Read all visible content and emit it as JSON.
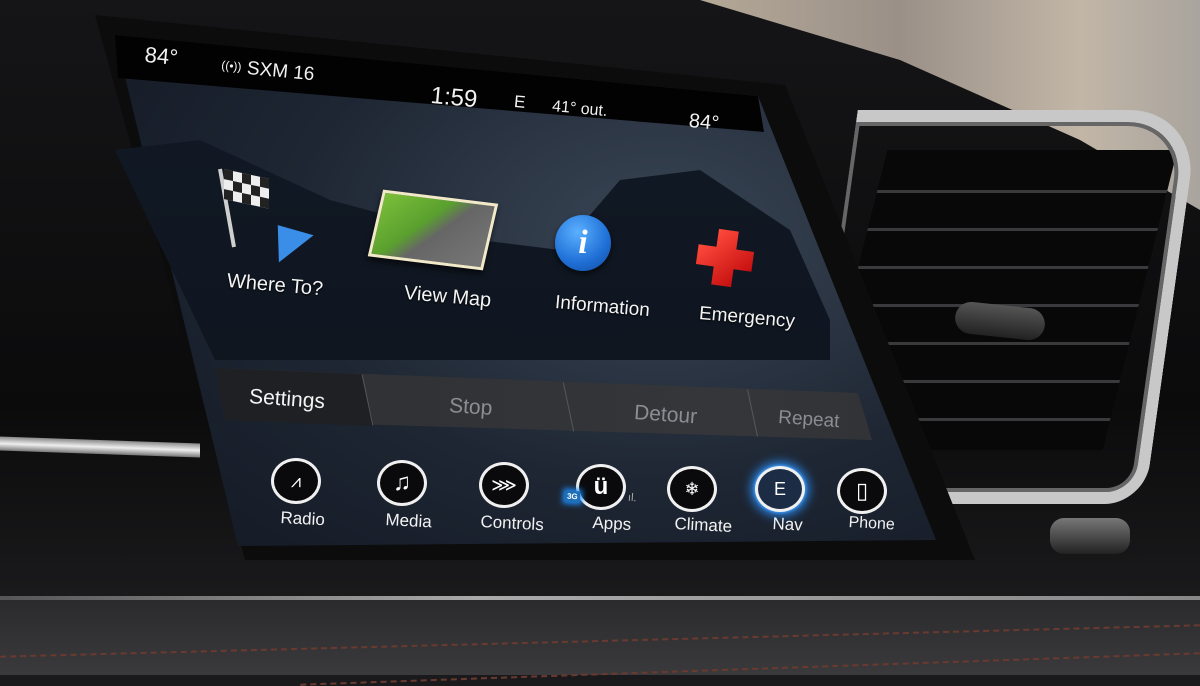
{
  "status_bar": {
    "left_temp": "84°",
    "radio_icon": "antenna-icon",
    "station": "SXM 16",
    "time": "1:59",
    "compass": "E",
    "outside_temp": "41° out.",
    "right_temp": "84°"
  },
  "nav_menu": {
    "tiles": [
      {
        "label": "Where To?",
        "icon": "checkered-flag-icon"
      },
      {
        "label": "View Map",
        "icon": "map-icon"
      },
      {
        "label": "Information",
        "icon": "info-icon"
      },
      {
        "label": "Emergency",
        "icon": "red-cross-icon"
      }
    ]
  },
  "action_bar": {
    "buttons": [
      {
        "label": "Settings",
        "enabled": true
      },
      {
        "label": "Stop",
        "enabled": false
      },
      {
        "label": "Detour",
        "enabled": false
      },
      {
        "label": "Repeat",
        "enabled": false
      }
    ]
  },
  "bottom_nav": {
    "items": [
      {
        "label": "Radio",
        "icon": "radio-tower-icon",
        "glyph": "📡"
      },
      {
        "label": "Media",
        "icon": "music-note-icon",
        "glyph": "♫"
      },
      {
        "label": "Controls",
        "icon": "seat-controls-icon",
        "glyph": "⋙"
      },
      {
        "label": "Apps",
        "icon": "uconnect-icon",
        "glyph": "ü"
      },
      {
        "label": "Climate",
        "icon": "climate-icon",
        "glyph": "❄"
      },
      {
        "label": "Nav",
        "icon": "compass-icon",
        "glyph": "E",
        "active": true
      },
      {
        "label": "Phone",
        "icon": "phone-icon",
        "glyph": "▯"
      }
    ],
    "apps_badge": "3G",
    "signal": "ıl."
  },
  "colors": {
    "accent": "#2a86e8",
    "emergency": "#e02020",
    "text": "#f2f2f2",
    "disabled_text": "#8a8d93"
  }
}
